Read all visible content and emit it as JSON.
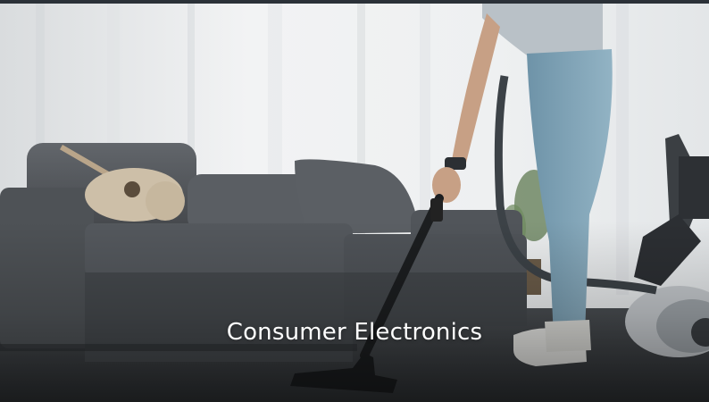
{
  "card": {
    "title": "Consumer Electronics"
  },
  "colors": {
    "wall": "#eceeef",
    "sofa": "#55595e",
    "jeans": "#7fa2b6",
    "floor": "#3e4246",
    "caption_text": "#ffffff"
  },
  "icons": {
    "photo_subject": "person vacuuming living room"
  }
}
